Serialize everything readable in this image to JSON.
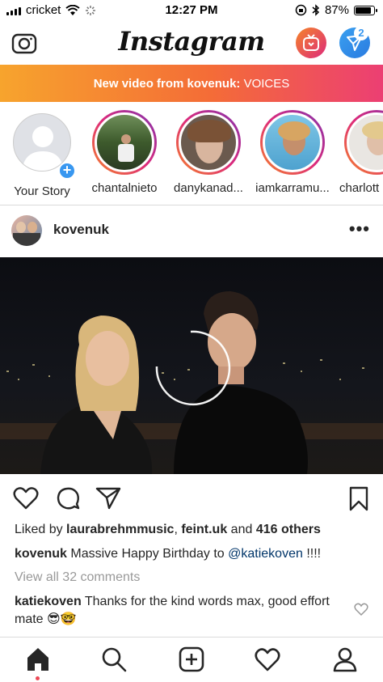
{
  "status_bar": {
    "carrier": "cricket",
    "time": "12:27 PM",
    "battery": "87%",
    "battery_level": 0.87
  },
  "header": {
    "logo": "Instagram",
    "dm_badge": "2",
    "icons": [
      "camera-icon",
      "igtv-icon",
      "direct-message-icon"
    ]
  },
  "banner": {
    "prefix": "New video from kovenuk:",
    "title": "VOICES"
  },
  "stories": [
    {
      "name": "Your Story"
    },
    {
      "name": "chantalnieto"
    },
    {
      "name": "danykanad..."
    },
    {
      "name": "iamkarramu..."
    },
    {
      "name": "charlott"
    }
  ],
  "post": {
    "username": "kovenuk",
    "more": "•••",
    "likes_prefix": "Liked by",
    "liked_user_1": "laurabrehmmusic",
    "liked_user_2": "feint.uk",
    "likes_and": "and",
    "likes_others": "416 others",
    "caption_user": "kovenuk",
    "caption_text": "Massive Happy Birthday to",
    "caption_mention": "@katiekoven",
    "caption_suffix": "!!!!",
    "view_comments": "View all 32 comments",
    "comment_user": "katiekoven",
    "comment_text": "Thanks for the kind words max, good effort mate 😎🤓"
  },
  "tabbar": {
    "items": [
      "home-icon",
      "search-icon",
      "new-post-icon",
      "activity-icon",
      "profile-icon"
    ]
  },
  "colors": {
    "accent": "#3897f0",
    "banner_start": "#f7a42d",
    "banner_end": "#ec3f73",
    "notification": "#ed4956"
  }
}
